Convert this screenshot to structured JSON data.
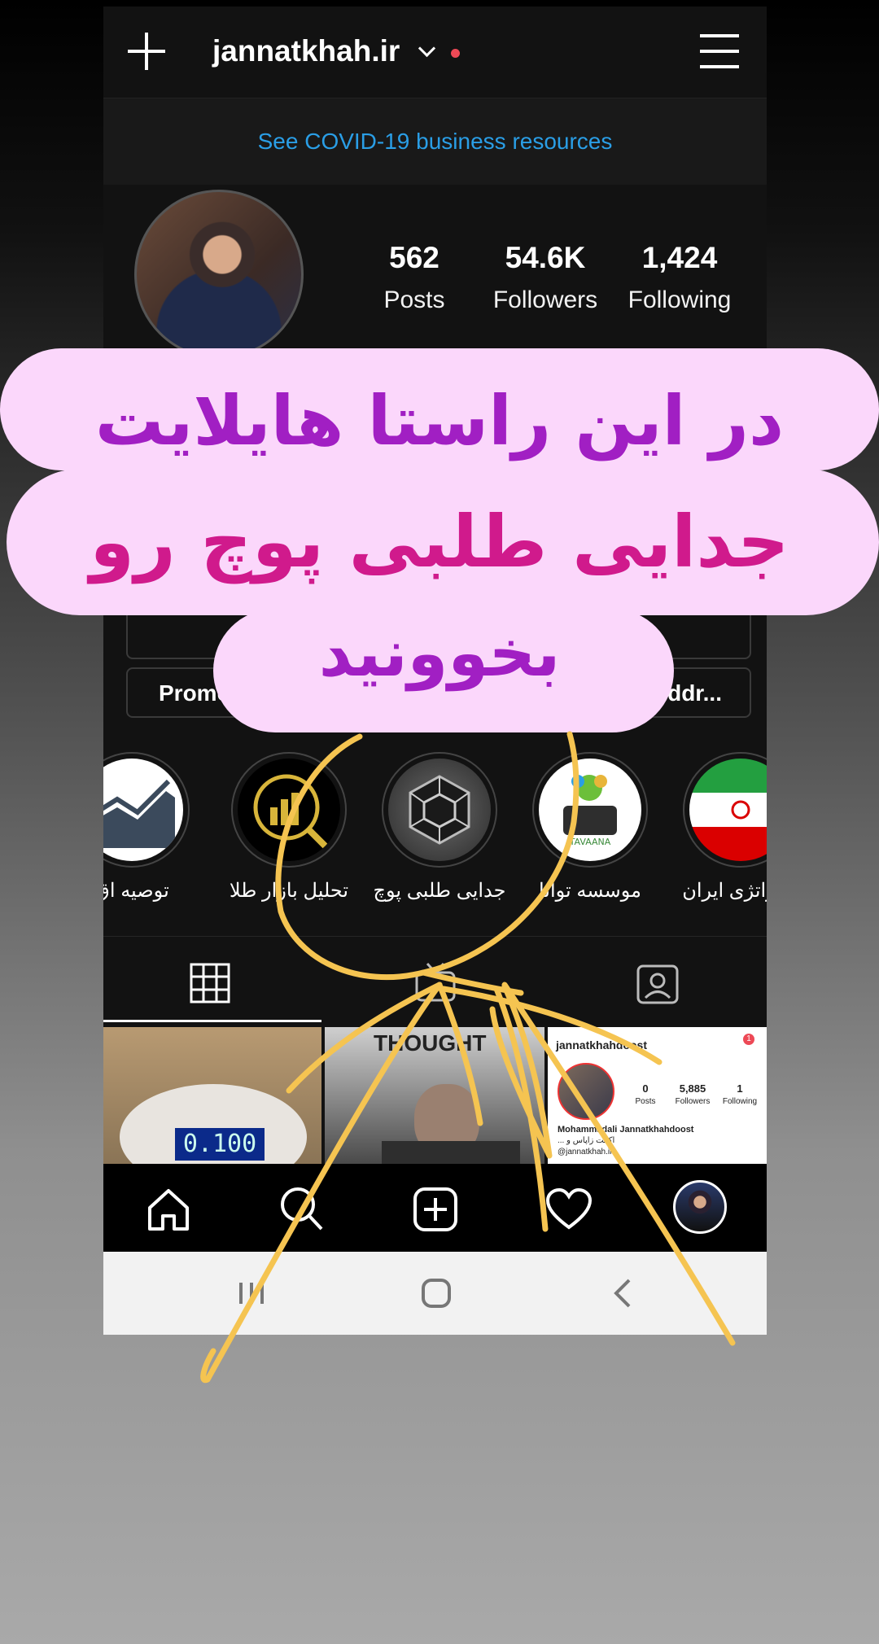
{
  "header": {
    "username": "jannatkhah.ir"
  },
  "banner": {
    "covid_link": "See COVID-19 business resources"
  },
  "stats": [
    {
      "value": "562",
      "label": "Posts"
    },
    {
      "value": "54.6K",
      "label": "Followers"
    },
    {
      "value": "1,424",
      "label": "Following"
    }
  ],
  "buttons": {
    "promo_partial": "Promo",
    "address_partial": "ddr..."
  },
  "highlights": [
    {
      "label": "توصیه اق",
      "icon": "chart-up-icon"
    },
    {
      "label": "تحلیل بازار طلا",
      "icon": "gold-chart-icon"
    },
    {
      "label": "جدایی طلبی پوچ",
      "icon": "hexagon-icon"
    },
    {
      "label": "موسسه توانا",
      "icon": "tavaana-logo"
    },
    {
      "label": "ستراتژی ایران",
      "icon": "iran-flag-icon"
    }
  ],
  "grid_preview": {
    "thought_text": "THOUGHT",
    "scale_display": "0.100",
    "profile_name": "jannatkhahdoost",
    "profile_stats": [
      {
        "value": "0",
        "label": "Posts"
      },
      {
        "value": "5,885",
        "label": "Followers"
      },
      {
        "value": "1",
        "label": "Following"
      }
    ],
    "profile_fullname": "Mohammadali Jannatkhahdoost",
    "profile_bio": "اکانت زاپاس و ...",
    "profile_handle": "@jannatkhah.ir",
    "notification_count": "1"
  },
  "overlay_text": {
    "line1": "در این راستا هایلایت",
    "line2": "جدایی طلبی پوچ رو",
    "line3": "بخوونید"
  },
  "colors": {
    "background": "#121212",
    "link_blue": "#2a9ee6",
    "bubble_pink": "#fbd7fb",
    "text_purple": "#a11fc3",
    "text_magenta": "#d01a8c",
    "scribble_yellow": "#f5c451"
  }
}
